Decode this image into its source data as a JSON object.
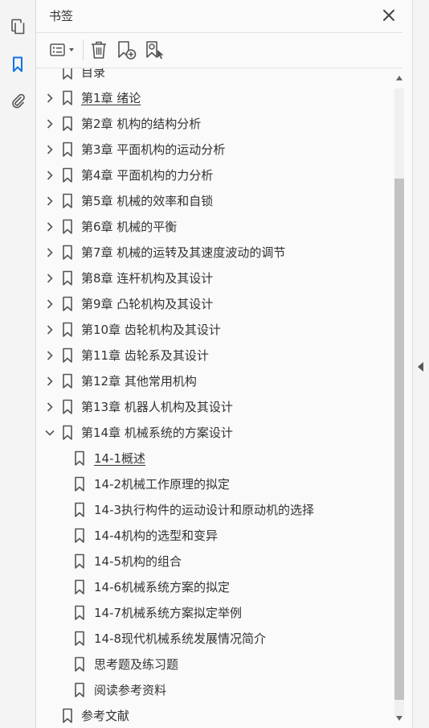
{
  "left_rail": {
    "icons": [
      "pages-icon",
      "bookmark-icon",
      "paperclip-icon"
    ],
    "active_color": "#1473e6"
  },
  "panel": {
    "title": "书签",
    "toolbar": [
      "options-menu-icon",
      "delete-icon",
      "new-bookmark-icon",
      "find-bookmark-icon"
    ]
  },
  "bookmarks": [
    {
      "label": "目录",
      "level": 0,
      "expander": "none",
      "clipped": true
    },
    {
      "label": "第1章  绪论",
      "level": 0,
      "expander": "collapsed",
      "underline": true
    },
    {
      "label": "第2章  机构的结构分析",
      "level": 0,
      "expander": "collapsed"
    },
    {
      "label": "第3章  平面机构的运动分析",
      "level": 0,
      "expander": "collapsed"
    },
    {
      "label": "第4章  平面机构的力分析",
      "level": 0,
      "expander": "collapsed"
    },
    {
      "label": "第5章  机械的效率和自锁",
      "level": 0,
      "expander": "collapsed"
    },
    {
      "label": "第6章  机械的平衡",
      "level": 0,
      "expander": "collapsed"
    },
    {
      "label": "第7章  机械的运转及其速度波动的调节",
      "level": 0,
      "expander": "collapsed"
    },
    {
      "label": "第8章  连杆机构及其设计",
      "level": 0,
      "expander": "collapsed"
    },
    {
      "label": "第9章  凸轮机构及其设计",
      "level": 0,
      "expander": "collapsed"
    },
    {
      "label": "第10章  齿轮机构及其设计",
      "level": 0,
      "expander": "collapsed"
    },
    {
      "label": "第11章  齿轮系及其设计",
      "level": 0,
      "expander": "collapsed"
    },
    {
      "label": "第12章  其他常用机构",
      "level": 0,
      "expander": "collapsed"
    },
    {
      "label": "第13章  机器人机构及其设计",
      "level": 0,
      "expander": "collapsed"
    },
    {
      "label": "第14章  机械系统的方案设计",
      "level": 0,
      "expander": "expanded"
    },
    {
      "label": "14-1概述",
      "level": 1,
      "expander": "none",
      "underline": true
    },
    {
      "label": "14-2机械工作原理的拟定",
      "level": 1,
      "expander": "none"
    },
    {
      "label": "14-3执行构件的运动设计和原动机的选择",
      "level": 1,
      "expander": "none"
    },
    {
      "label": "14-4机构的选型和变异",
      "level": 1,
      "expander": "none"
    },
    {
      "label": "14-5机构的组合",
      "level": 1,
      "expander": "none"
    },
    {
      "label": "14-6机械系统方案的拟定",
      "level": 1,
      "expander": "none"
    },
    {
      "label": "14-7机械系统方案拟定举例",
      "level": 1,
      "expander": "none"
    },
    {
      "label": "14-8现代机械系统发展情况简介",
      "level": 1,
      "expander": "none"
    },
    {
      "label": "思考题及练习题",
      "level": 1,
      "expander": "none"
    },
    {
      "label": "阅读参考资料",
      "level": 1,
      "expander": "none"
    },
    {
      "label": "参考文献",
      "level": 0,
      "expander": "none"
    }
  ],
  "scrollbar": {
    "scroll_fraction": 0.85
  }
}
